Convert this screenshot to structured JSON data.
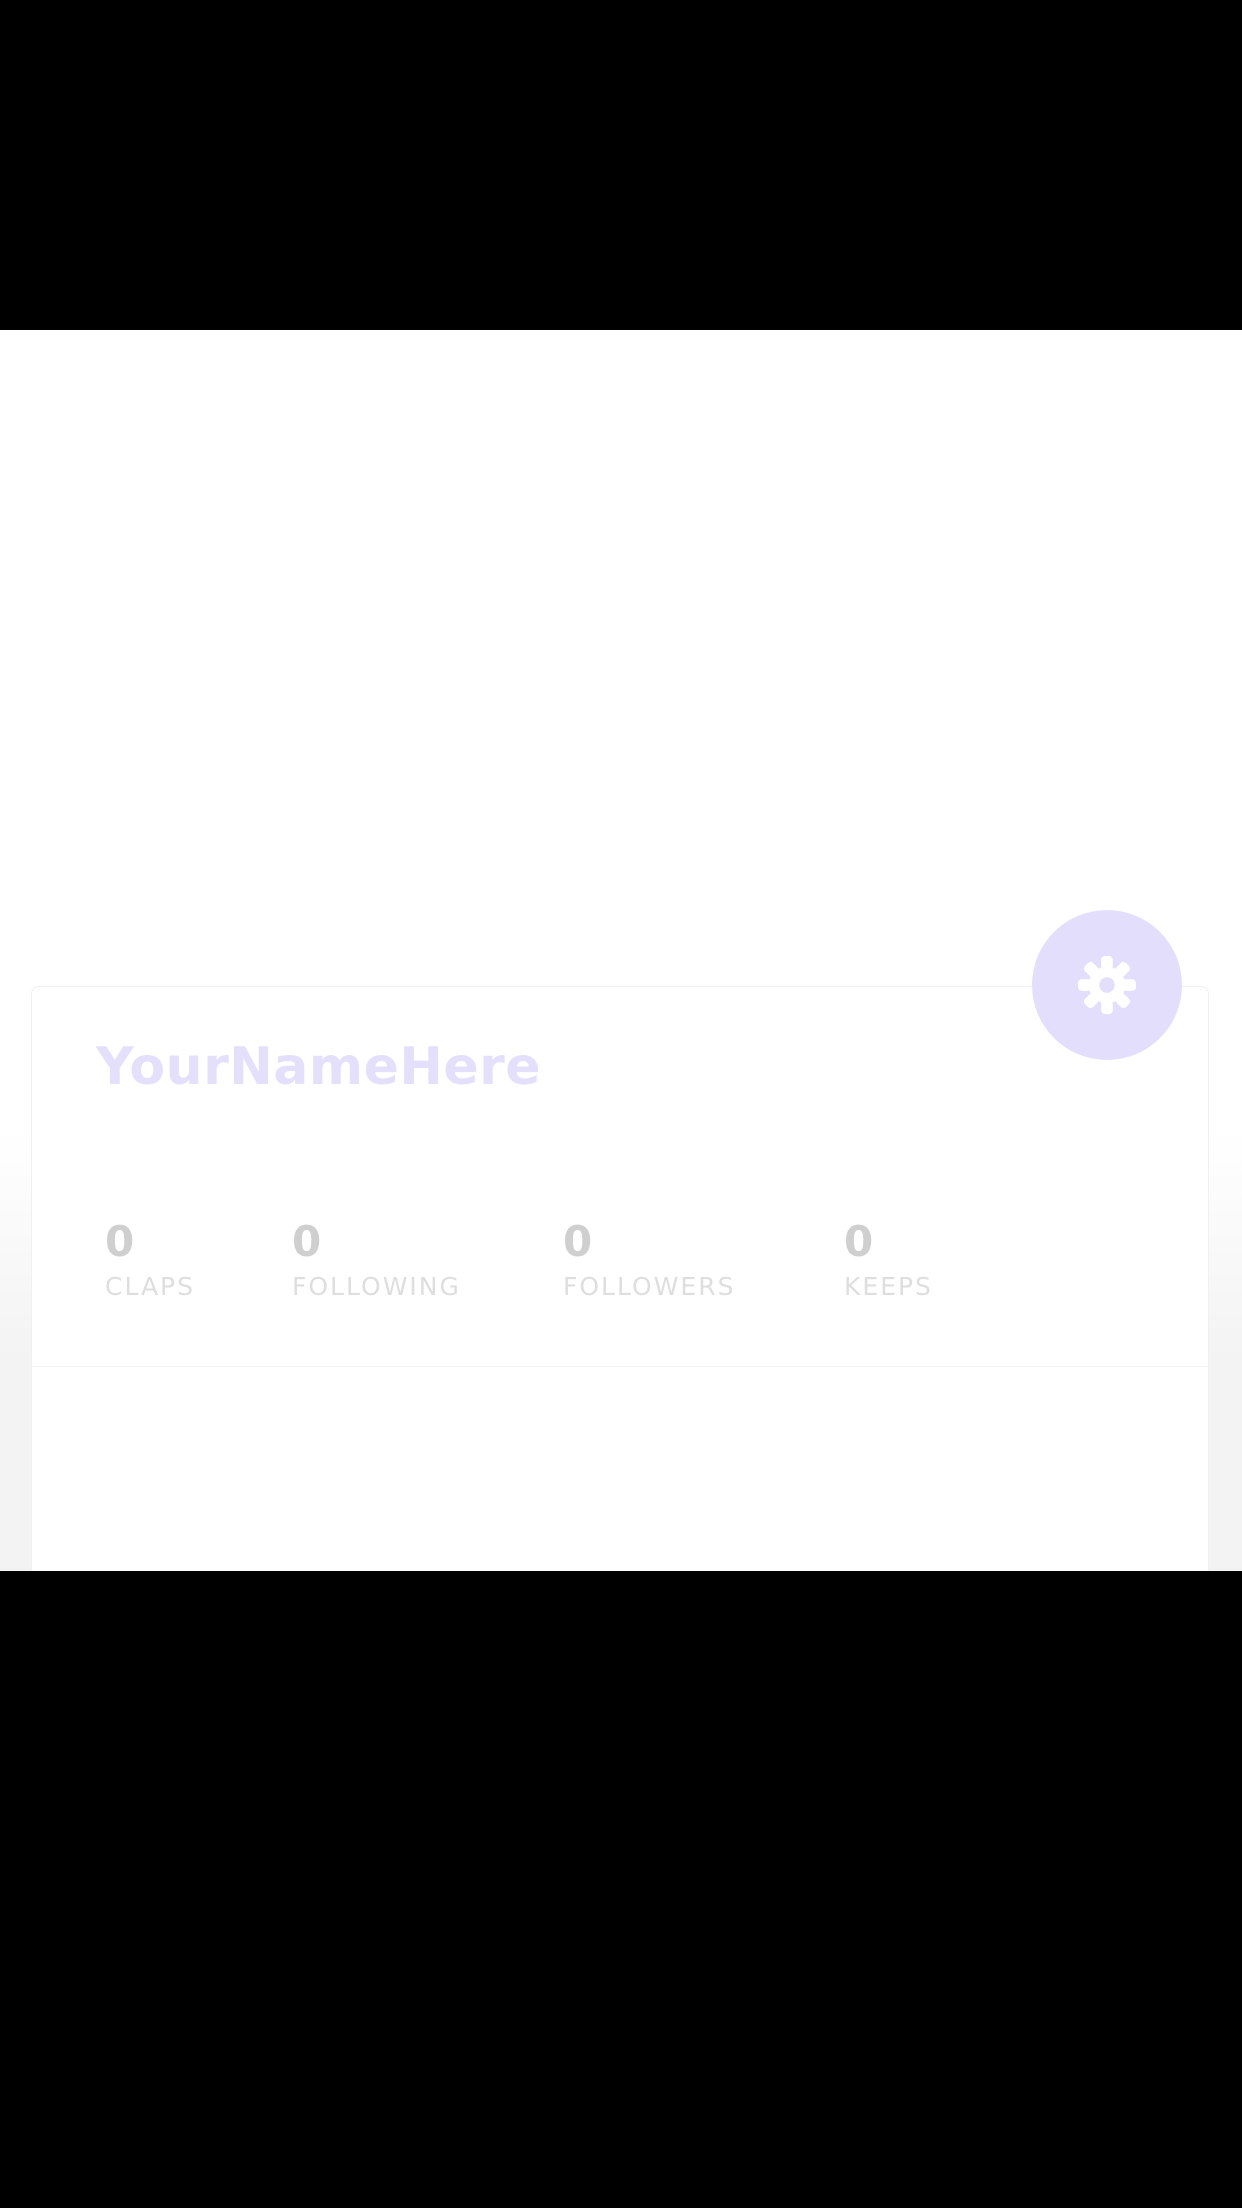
{
  "profile": {
    "name": "YourNameHere"
  },
  "stats": [
    {
      "value": "0",
      "label": "CLAPS"
    },
    {
      "value": "0",
      "label": "FOLLOWING"
    },
    {
      "value": "0",
      "label": "FOLLOWERS"
    },
    {
      "value": "0",
      "label": "KEEPS"
    }
  ],
  "settings_button": {
    "icon": "gear-icon"
  },
  "colors": {
    "accent": "#e2defb",
    "name_text": "#e4e0fb",
    "stat_value": "#cfcfcf",
    "stat_label": "#dedede"
  }
}
